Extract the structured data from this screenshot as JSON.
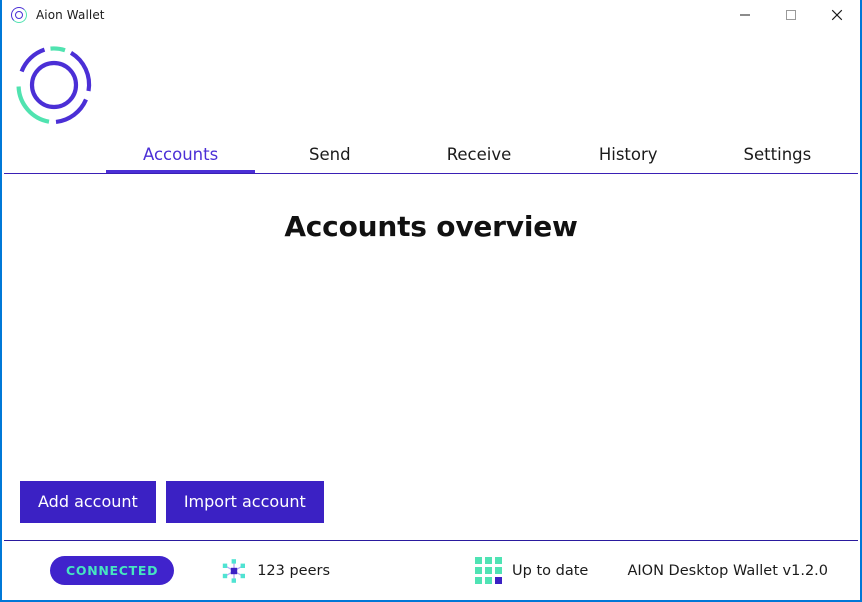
{
  "window": {
    "title": "Aion Wallet",
    "icon": "aion-ring-icon",
    "controls": {
      "minimize": "minimize-icon",
      "maximize": "maximize-icon",
      "close": "close-icon"
    },
    "border_color": "#0078d7"
  },
  "brand": {
    "logo": "aion-logo",
    "logo_purple": "#4b2fd6",
    "logo_teal": "#50e3b0"
  },
  "nav": {
    "tabs": [
      {
        "label": "Accounts",
        "active": true
      },
      {
        "label": "Send",
        "active": false
      },
      {
        "label": "Receive",
        "active": false
      },
      {
        "label": "History",
        "active": false
      },
      {
        "label": "Settings",
        "active": false
      }
    ],
    "active_color": "#4b2fd6",
    "rule_color": "#3a20b5"
  },
  "main": {
    "page_title": "Accounts overview",
    "accounts": [],
    "buttons": [
      {
        "label": "Add account",
        "name": "add-account-button"
      },
      {
        "label": "Import account",
        "name": "import-account-button"
      }
    ],
    "button_color": "#3b21c4"
  },
  "status": {
    "connection": {
      "label": "CONNECTED",
      "pill_bg": "#4023cc",
      "text_color": "#46e5c0"
    },
    "peers": {
      "icon": "network-node-icon",
      "label": "123 peers"
    },
    "sync": {
      "icon": "blocks-grid-icon",
      "label": "Up to date"
    },
    "version": "AION Desktop Wallet v1.2.0"
  }
}
